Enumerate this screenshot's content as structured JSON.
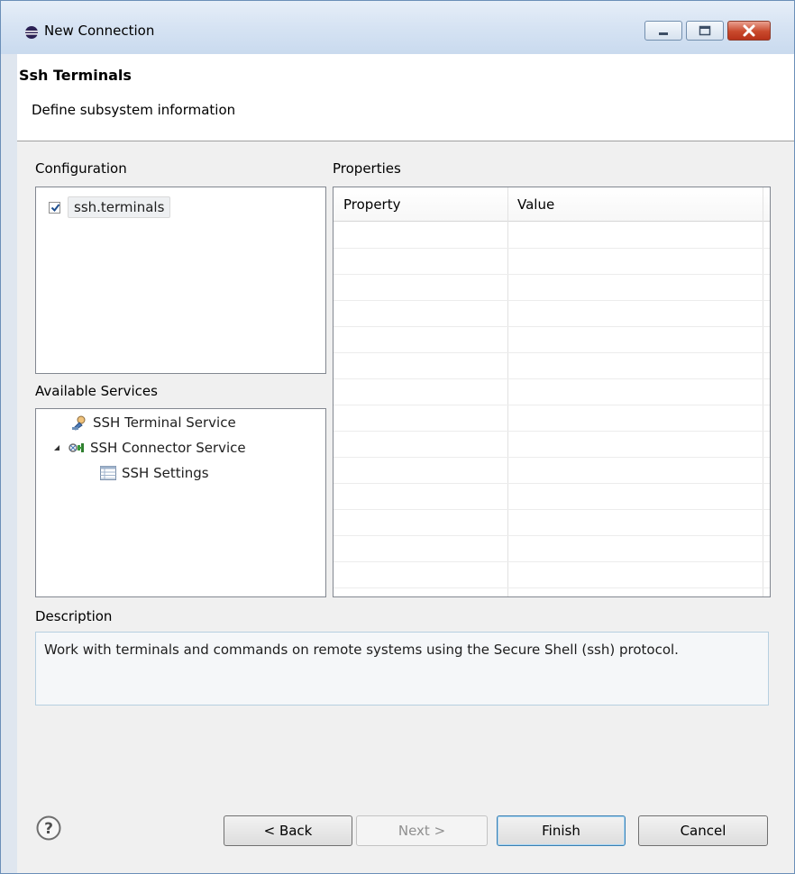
{
  "window": {
    "title": "New Connection",
    "icon": "eclipse-icon"
  },
  "header": {
    "title": "Ssh Terminals",
    "subtitle": "Define subsystem information"
  },
  "configuration": {
    "label": "Configuration",
    "items": [
      {
        "label": "ssh.terminals",
        "checked": true
      }
    ]
  },
  "services": {
    "label": "Available Services",
    "items": [
      {
        "label": "SSH Terminal Service",
        "icon": "terminal-service-icon"
      },
      {
        "label": "SSH Connector Service",
        "icon": "connector-service-icon",
        "expanded": true
      },
      {
        "label": "SSH Settings",
        "icon": "settings-table-icon"
      }
    ]
  },
  "properties": {
    "label": "Properties",
    "columns": [
      "Property",
      "Value"
    ],
    "rows": []
  },
  "description": {
    "label": "Description",
    "text": "Work with terminals and commands on remote systems using the Secure Shell (ssh) protocol."
  },
  "buttons": {
    "back": "< Back",
    "next": "Next >",
    "finish": "Finish",
    "cancel": "Cancel"
  },
  "colors": {
    "accent": "#3c7fb1",
    "close": "#c9492c",
    "header_bg": "#ffffff",
    "dialog_bg": "#f0f0f0"
  }
}
